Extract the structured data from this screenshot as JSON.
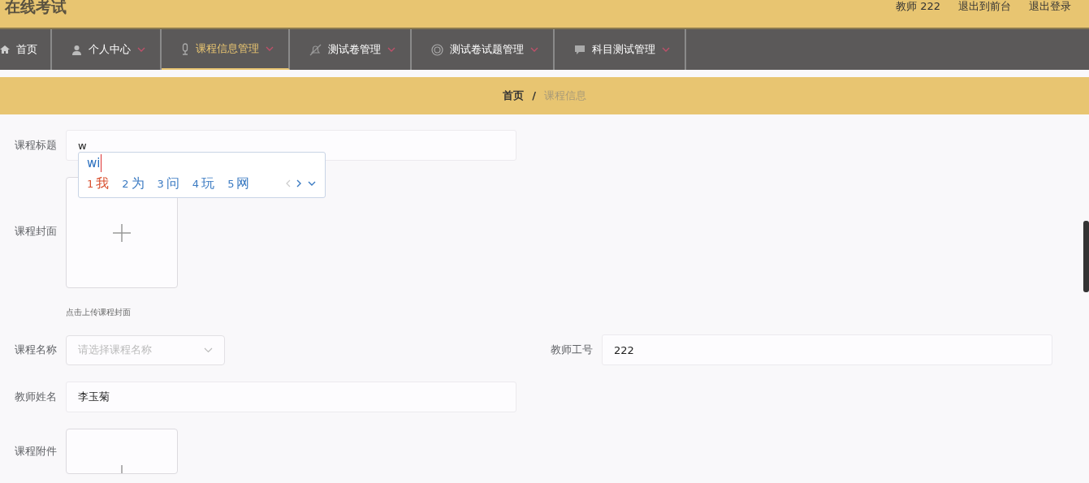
{
  "header": {
    "title": "在线考试",
    "user": "教师 222",
    "links": [
      "退出到前台",
      "退出登录"
    ]
  },
  "nav": [
    {
      "label": "首页",
      "dropdown": false,
      "selected": false
    },
    {
      "label": "个人中心",
      "dropdown": true,
      "selected": false
    },
    {
      "label": "课程信息管理",
      "dropdown": true,
      "selected": true
    },
    {
      "label": "测试卷管理",
      "dropdown": true,
      "selected": false
    },
    {
      "label": "测试卷试题管理",
      "dropdown": true,
      "selected": false
    },
    {
      "label": "科目测试管理",
      "dropdown": true,
      "selected": false
    }
  ],
  "breadcrumb_separator": "/",
  "breadcrumb": [
    {
      "label": "首页",
      "current": false
    },
    {
      "label": "课程信息",
      "current": true
    }
  ],
  "form": [
    {
      "fields": [
        {
          "kind": "text",
          "label": "课程标题",
          "value": "w"
        }
      ]
    },
    {
      "fields": [
        {
          "kind": "upload",
          "label": "课程封面",
          "hint": "点击上传课程封面"
        }
      ]
    },
    {
      "fields": [
        {
          "kind": "select",
          "label": "课程名称",
          "placeholder": "请选择课程名称"
        },
        {
          "kind": "text",
          "label": "教师工号",
          "value": "222"
        }
      ]
    },
    {
      "fields": [
        {
          "kind": "text",
          "label": "教师姓名",
          "value": "李玉菊"
        }
      ]
    },
    {
      "fields": [
        {
          "kind": "upload",
          "label": "课程附件"
        }
      ]
    }
  ],
  "ime": {
    "composition": "wi",
    "candidates": [
      {
        "number": "1",
        "text": "我",
        "selected": true
      },
      {
        "number": "2",
        "text": "为",
        "selected": false
      },
      {
        "number": "3",
        "text": "问",
        "selected": false
      },
      {
        "number": "4",
        "text": "玩",
        "selected": false
      },
      {
        "number": "5",
        "text": "网",
        "selected": false
      }
    ]
  }
}
